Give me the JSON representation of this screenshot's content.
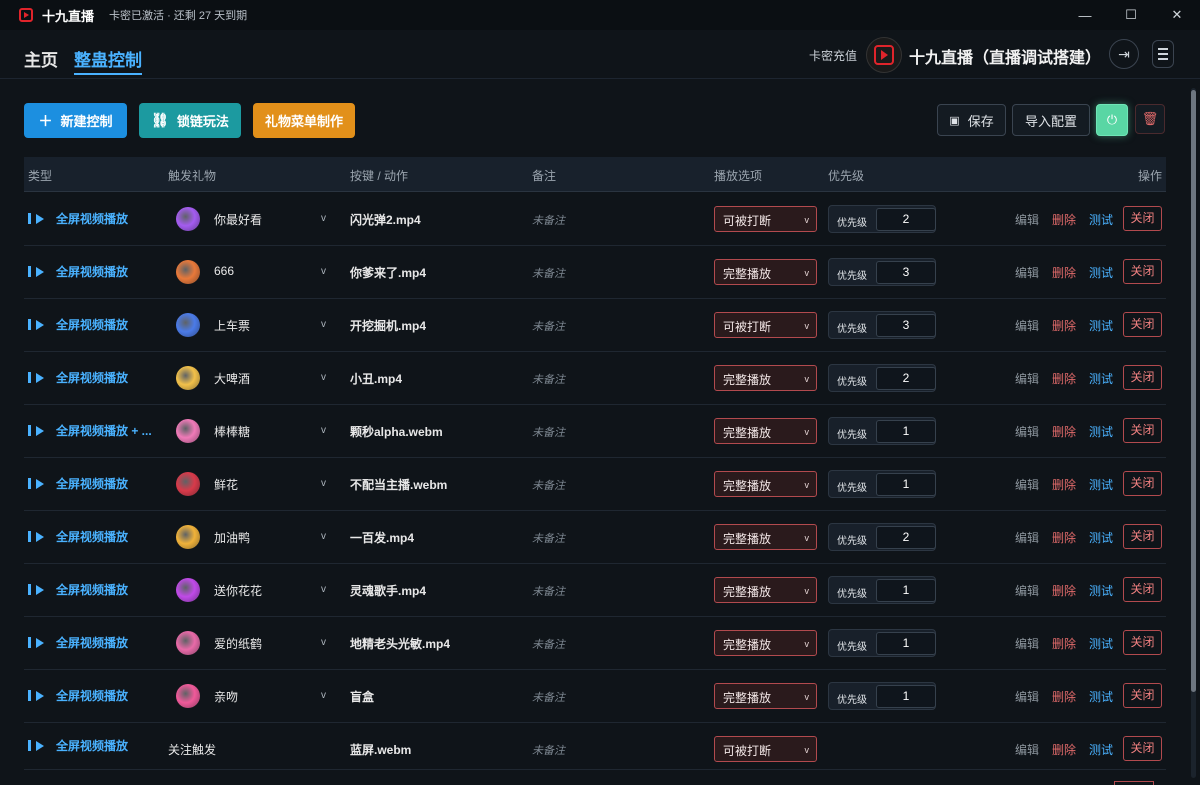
{
  "app": {
    "title": "十九直播",
    "status": "卡密已激活 · 还剩 27 天到期"
  },
  "window": {
    "minimize": "—",
    "maximize": "☐",
    "close": "✕"
  },
  "header": {
    "tabs": [
      {
        "label": "主页",
        "active": false
      },
      {
        "label": "整蛊控制",
        "active": true
      }
    ],
    "recharge": "卡密充值",
    "room_name": "十九直播（直播调试搭建）"
  },
  "toolbar": {
    "new_control": "新建控制",
    "chain_play": "锁链玩法",
    "gift_menu": "礼物菜单制作",
    "save": "保存",
    "import_config": "导入配置"
  },
  "table": {
    "headers": {
      "type": "类型",
      "gift": "触发礼物",
      "action": "按键 / 动作",
      "note": "备注",
      "play": "播放选项",
      "priority": "优先级",
      "ops": "操作"
    },
    "priority_label": "优先级",
    "ops": {
      "edit": "编辑",
      "delete": "删除",
      "test": "测试",
      "close": "关闭"
    },
    "rows": [
      {
        "type": "全屏视频播放",
        "gift": "你最好看",
        "icon": "gift-icon-beauty",
        "color": "#a45cf0",
        "action": "闪光弹2.mp4",
        "note": "未备注",
        "play": "可被打断",
        "priority": "2"
      },
      {
        "type": "全屏视频播放",
        "gift": "666",
        "icon": "gift-icon-666",
        "color": "#e8793a",
        "action": "你爹来了.mp4",
        "note": "未备注",
        "play": "完整播放",
        "priority": "3"
      },
      {
        "type": "全屏视频播放",
        "gift": "上车票",
        "icon": "gift-icon-ticket",
        "color": "#4b7be8",
        "action": "开挖掘机.mp4",
        "note": "未备注",
        "play": "可被打断",
        "priority": "3"
      },
      {
        "type": "全屏视频播放",
        "gift": "大啤酒",
        "icon": "gift-icon-beer",
        "color": "#f2c14a",
        "action": "小丑.mp4",
        "note": "未备注",
        "play": "完整播放",
        "priority": "2"
      },
      {
        "type": "全屏视频播放 + ...",
        "gift": "棒棒糖",
        "icon": "gift-icon-lollipop",
        "color": "#f07ab8",
        "action": "颗秒alpha.webm",
        "note": "未备注",
        "play": "完整播放",
        "priority": "1"
      },
      {
        "type": "全屏视频播放",
        "gift": "鲜花",
        "icon": "gift-icon-flower",
        "color": "#d83a4a",
        "action": "不配当主播.webm",
        "note": "未备注",
        "play": "完整播放",
        "priority": "1"
      },
      {
        "type": "全屏视频播放",
        "gift": "加油鸭",
        "icon": "gift-icon-duck",
        "color": "#f0b23a",
        "action": "一百发.mp4",
        "note": "未备注",
        "play": "完整播放",
        "priority": "2"
      },
      {
        "type": "全屏视频播放",
        "gift": "送你花花",
        "icon": "gift-icon-flowers",
        "color": "#c04ae8",
        "action": "灵魂歌手.mp4",
        "note": "未备注",
        "play": "完整播放",
        "priority": "1"
      },
      {
        "type": "全屏视频播放",
        "gift": "爱的纸鹤",
        "icon": "gift-icon-crane",
        "color": "#e86aa8",
        "action": "地精老头光敏.mp4",
        "note": "未备注",
        "play": "完整播放",
        "priority": "1"
      },
      {
        "type": "全屏视频播放",
        "gift": "亲吻",
        "icon": "gift-icon-kiss",
        "color": "#f05a9a",
        "action": "盲盒",
        "note": "未备注",
        "play": "完整播放",
        "priority": "1"
      },
      {
        "type": "全屏视频播放",
        "gift": "关注触发",
        "icon": "",
        "color": "",
        "action": "蓝屏.webm",
        "note": "未备注",
        "play": "可被打断",
        "priority": ""
      }
    ]
  }
}
